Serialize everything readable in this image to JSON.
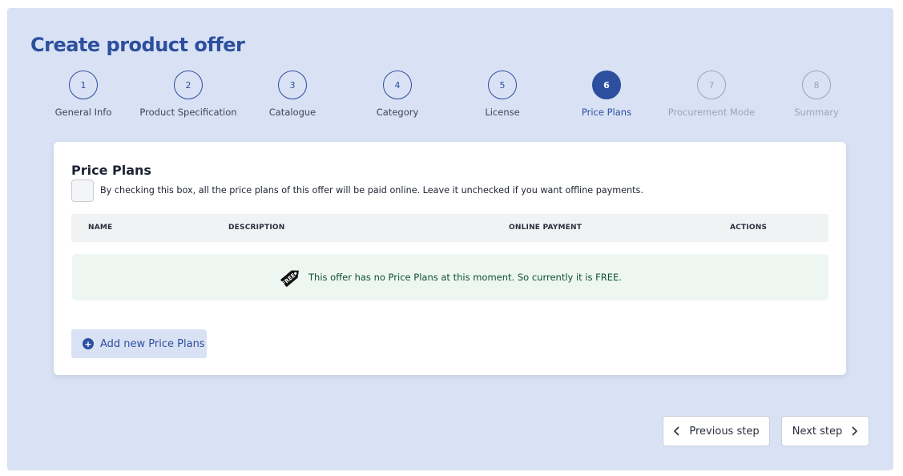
{
  "page": {
    "title": "Create product offer"
  },
  "steps": [
    {
      "number": "1",
      "label": "General Info",
      "state": "done"
    },
    {
      "number": "2",
      "label": "Product Specification",
      "state": "done"
    },
    {
      "number": "3",
      "label": "Catalogue",
      "state": "done"
    },
    {
      "number": "4",
      "label": "Category",
      "state": "done"
    },
    {
      "number": "5",
      "label": "License",
      "state": "done"
    },
    {
      "number": "6",
      "label": "Price Plans",
      "state": "active"
    },
    {
      "number": "7",
      "label": "Procurement Mode",
      "state": "future"
    },
    {
      "number": "8",
      "label": "Summary",
      "state": "future"
    }
  ],
  "card": {
    "title": "Price Plans",
    "checkbox_checked": false,
    "checkbox_text": "By checking this box, all the price plans of this offer will be paid online. Leave it unchecked if you want offline payments.",
    "table_headers": [
      "NAME",
      "DESCRIPTION",
      "ONLINE PAYMENT",
      "ACTIONS"
    ],
    "empty_notice": "This offer has no Price Plans at this moment. So currently it is FREE.",
    "empty_icon": "free-tag-icon",
    "add_button_label": "Add new Price Plans",
    "add_button_icon": "plus-circle-icon"
  },
  "navigation": {
    "previous_label": "Previous step",
    "next_label": "Next step"
  },
  "colors": {
    "accent": "#2c4f9e",
    "background": "#d9e1f4",
    "notice_bg": "#eef6f2",
    "notice_text": "#0f5132"
  }
}
